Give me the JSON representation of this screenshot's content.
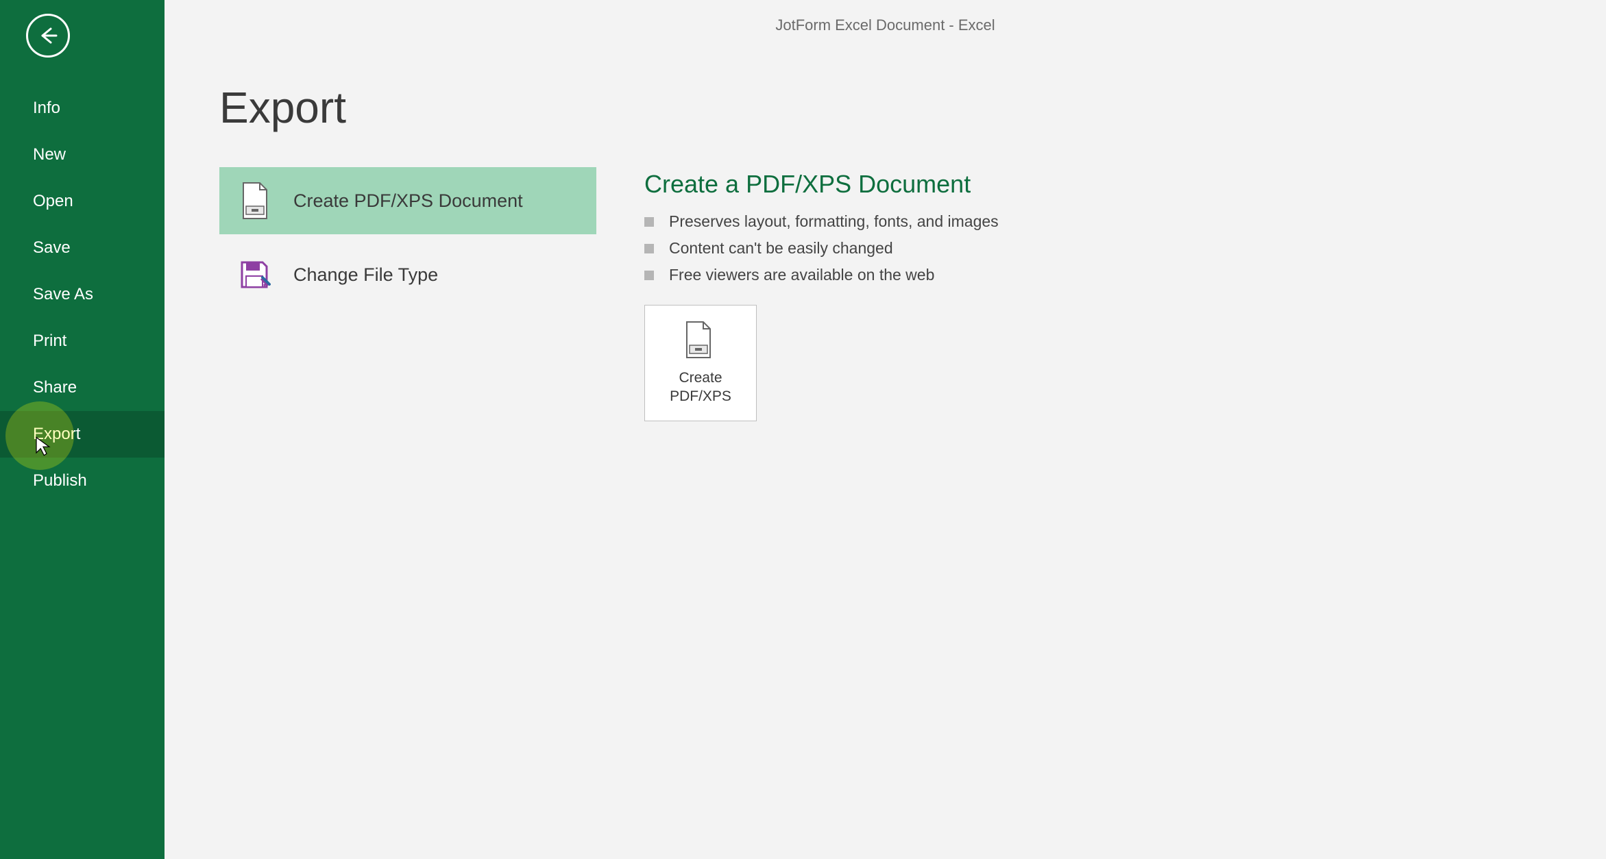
{
  "app_title": "JotForm Excel Document - Excel",
  "sidebar": {
    "items": [
      {
        "label": "Info"
      },
      {
        "label": "New"
      },
      {
        "label": "Open"
      },
      {
        "label": "Save"
      },
      {
        "label": "Save As"
      },
      {
        "label": "Print"
      },
      {
        "label": "Share"
      },
      {
        "label": "Export"
      },
      {
        "label": "Publish"
      }
    ]
  },
  "page": {
    "title": "Export"
  },
  "options": {
    "pdfxps": "Create PDF/XPS Document",
    "change_type": "Change File Type"
  },
  "details": {
    "title": "Create a PDF/XPS Document",
    "bullets": [
      "Preserves layout, formatting, fonts, and images",
      "Content can't be easily changed",
      "Free viewers are available on the web"
    ],
    "action_label": "Create\nPDF/XPS"
  }
}
